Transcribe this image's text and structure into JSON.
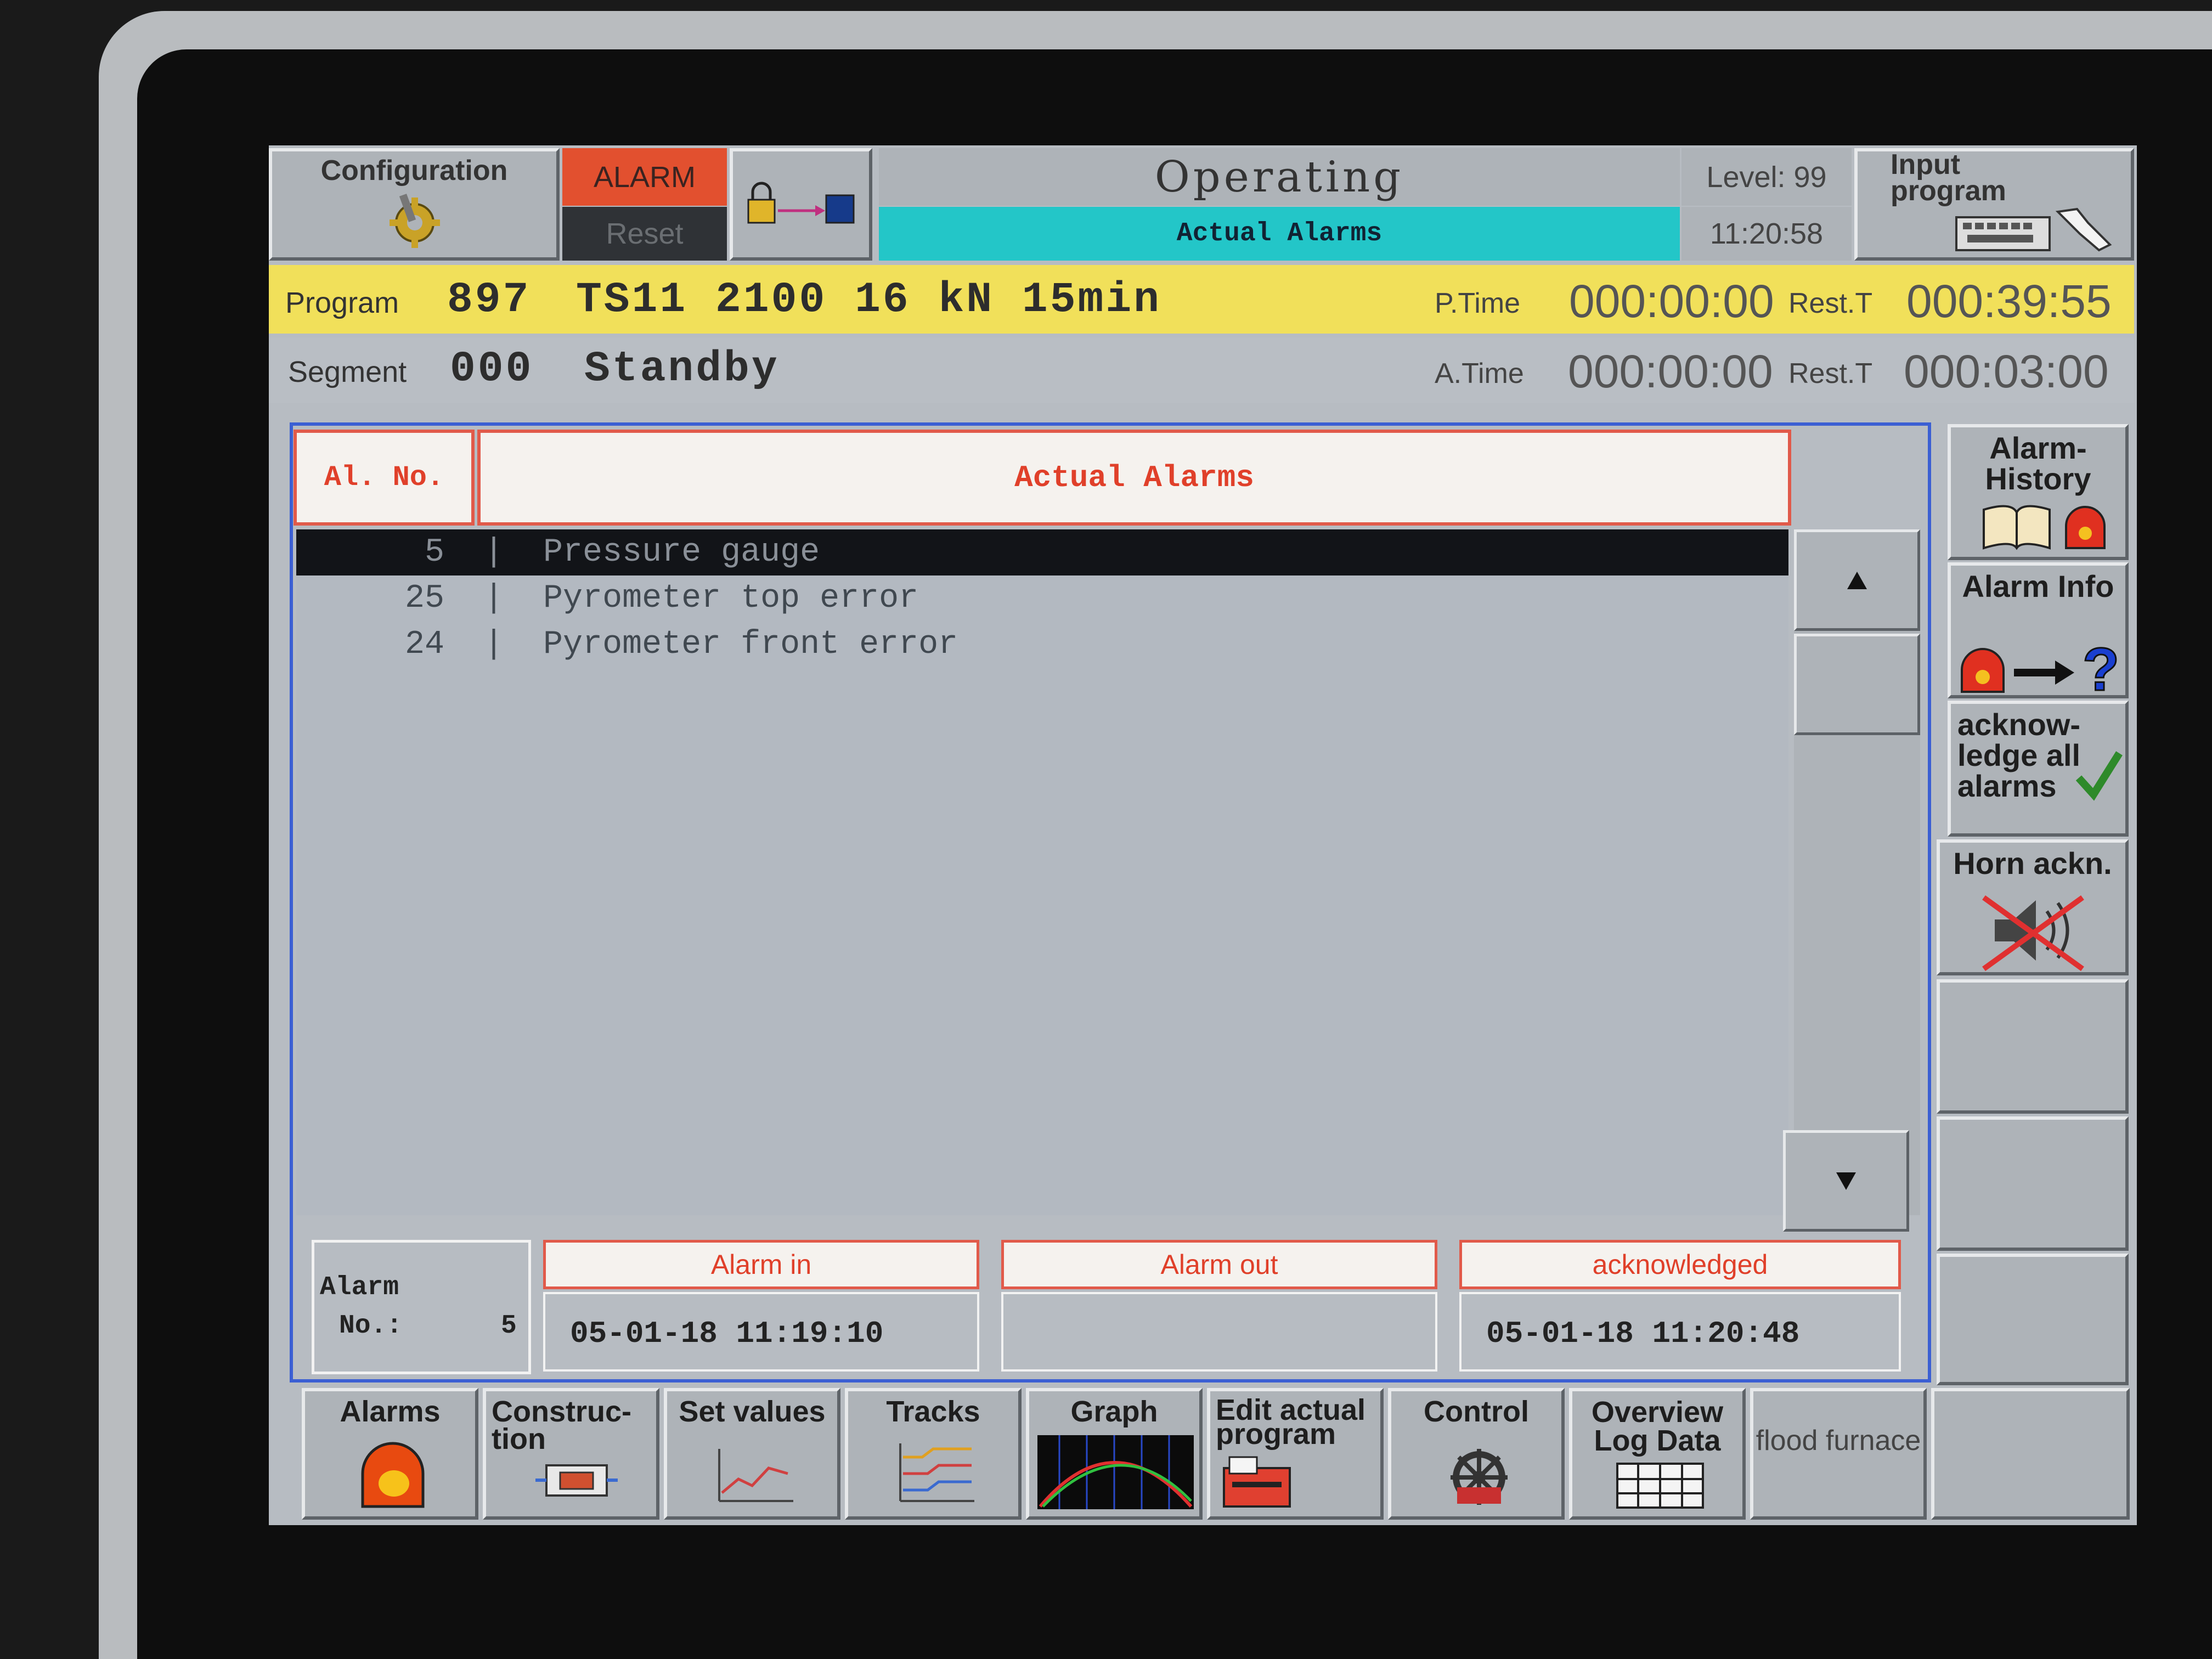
{
  "topbar": {
    "configuration_label": "Configuration",
    "alarm_label": "ALARM",
    "reset_label": "Reset",
    "mode_title": "Operating",
    "screen_subtitle": "Actual Alarms",
    "level_text": "Level: 99",
    "clock": "11:20:58",
    "input_program_label": "Input program"
  },
  "program_row": {
    "label": "Program",
    "number": "897",
    "name": "TS11 2100 16 kN 15min",
    "ptime_label": "P.Time",
    "ptime_value": "000:00:00",
    "rest_label": "Rest.T",
    "rest_value": "000:39:55"
  },
  "segment_row": {
    "label": "Segment",
    "number": "000",
    "name": "Standby",
    "atime_label": "A.Time",
    "atime_value": "000:00:00",
    "rest_label": "Rest.T",
    "rest_value": "000:03:00"
  },
  "alarm_table": {
    "col_no": "Al. No.",
    "col_title": "Actual Alarms",
    "rows": [
      {
        "no": "5",
        "sep": "|",
        "text": "Pressure gauge"
      },
      {
        "no": "25",
        "sep": "|",
        "text": "Pyrometer top error"
      },
      {
        "no": "24",
        "sep": "|",
        "text": "Pyrometer front error"
      }
    ]
  },
  "alarm_detail": {
    "label_line1": "Alarm",
    "label_line2": "No.:",
    "number": "5",
    "alarm_in_label": "Alarm in",
    "alarm_in_value": "05-01-18  11:19:10",
    "alarm_out_label": "Alarm out",
    "alarm_out_value": "",
    "ack_label": "acknowledged",
    "ack_value": "05-01-18  11:20:48"
  },
  "side_buttons": {
    "alarm_history": "Alarm-History",
    "alarm_info": "Alarm Info",
    "ack_all": "acknow-ledge all alarms",
    "horn_ack": "Horn ackn."
  },
  "bottom_buttons": {
    "alarms": "Alarms",
    "construction": "Construc-tion",
    "set_values": "Set values",
    "tracks": "Tracks",
    "graph": "Graph",
    "edit_actual_program": "Edit actual program",
    "control": "Control",
    "overview_log": "Overview Log Data",
    "flood_furnace": "flood furnace"
  },
  "colors": {
    "alarm_red": "#e2502f",
    "subtitle_cyan": "#23c6c8",
    "program_yellow": "#f1e05a",
    "header_red": "#e0402a",
    "frame_blue": "#3b5fd3"
  }
}
